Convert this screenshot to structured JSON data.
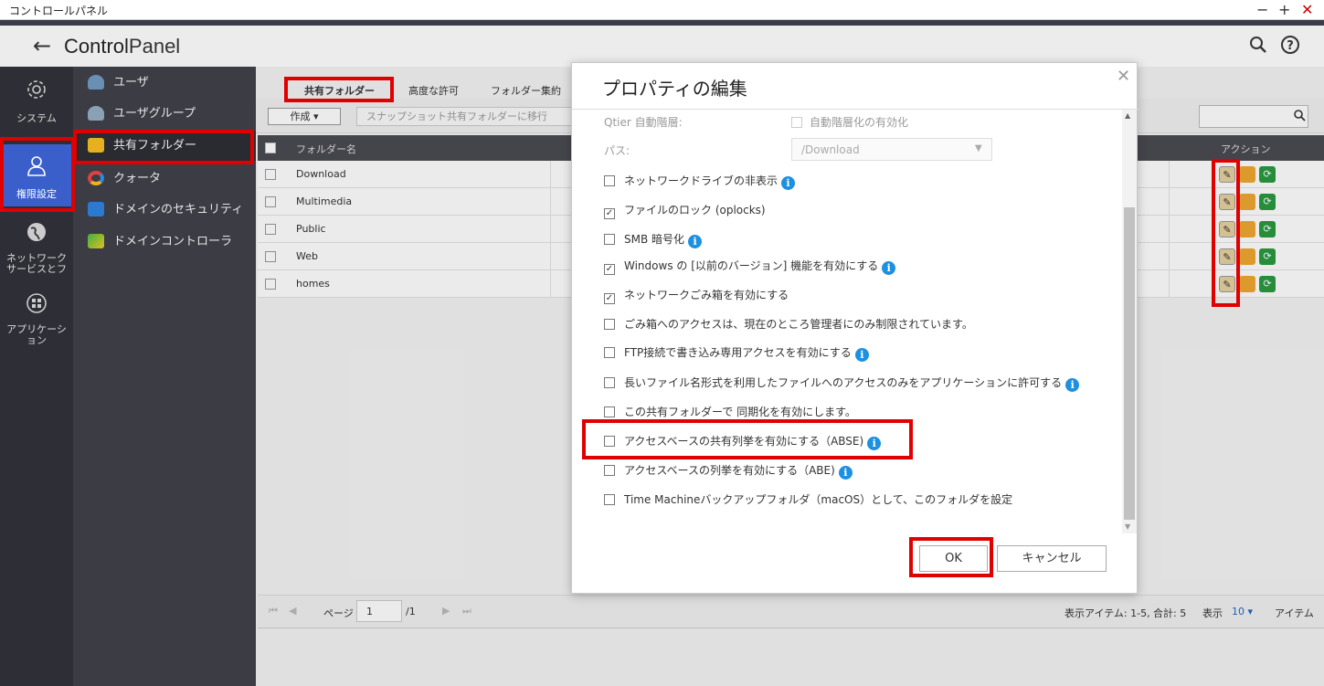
{
  "window": {
    "title": "コントロールパネル",
    "minimize": "−",
    "maximize": "+",
    "close": "✕"
  },
  "header": {
    "brand_bold": "Control",
    "brand_light": "Panel",
    "search_icon": "search-icon",
    "help_icon": "help-icon"
  },
  "leftnav": [
    {
      "label": "システム",
      "icon": "gear-icon"
    },
    {
      "label": "権限設定",
      "icon": "user-icon"
    },
    {
      "label_1": "ネットワーク",
      "label_2": "サービスとフ",
      "icon": "globe-icon"
    },
    {
      "label_1": "アプリケーシ",
      "label_2": "ョン",
      "icon": "apps-icon"
    }
  ],
  "subnav": [
    {
      "label": "ユーザ"
    },
    {
      "label": "ユーザグループ"
    },
    {
      "label": "共有フォルダー"
    },
    {
      "label": "クォータ"
    },
    {
      "label": "ドメインのセキュリティ"
    },
    {
      "label": "ドメインコントローラ"
    }
  ],
  "tabs": [
    {
      "label": "共有フォルダー"
    },
    {
      "label": "高度な許可"
    },
    {
      "label": "フォルダー集約"
    }
  ],
  "toolbar": {
    "create": "作成",
    "snapshot": "スナップショット共有フォルダーに移行"
  },
  "table": {
    "col_name": "フォルダー名",
    "col_action": "アクション",
    "rows": [
      "Download",
      "Multimedia",
      "Public",
      "Web",
      "homes"
    ]
  },
  "pager": {
    "page_label": "ページ",
    "page_value": "1",
    "page_total": "/1",
    "items_info": "表示アイテム: 1-5, 合計: 5",
    "show_label": "表示",
    "show_value": "10",
    "items_label": "アイテム"
  },
  "dialog": {
    "title": "プロパティの編集",
    "qtier_label": "Qtier 自動階層:",
    "qtier_option": "自動階層化の有効化",
    "path_label": "パス:",
    "path_value": "/Download",
    "options": [
      {
        "label": "ネットワークドライブの非表示",
        "checked": false,
        "info": true
      },
      {
        "label": "ファイルのロック (oplocks)",
        "checked": true,
        "info": false
      },
      {
        "label": "SMB 暗号化",
        "checked": false,
        "info": true
      },
      {
        "label": "Windows の [以前のバージョン] 機能を有効にする",
        "checked": true,
        "info": true
      },
      {
        "label": "ネットワークごみ箱を有効にする",
        "checked": true,
        "info": false
      },
      {
        "label": "ごみ箱へのアクセスは、現在のところ管理者にのみ制限されています。",
        "checked": false,
        "info": false
      },
      {
        "label": "FTP接続で書き込み専用アクセスを有効にする",
        "checked": false,
        "info": true
      },
      {
        "label": "長いファイル名形式を利用したファイルへのアクセスのみをアプリケーションに許可する",
        "checked": false,
        "info": true
      },
      {
        "label": "この共有フォルダーで 同期化を有効にします。",
        "checked": false,
        "info": false
      },
      {
        "label": "アクセスベースの共有列挙を有効にする（ABSE)",
        "checked": false,
        "info": true
      },
      {
        "label": "アクセスベースの列挙を有効にする（ABE)",
        "checked": false,
        "info": true
      },
      {
        "label": "Time Machineバックアップフォルダ（macOS）として、このフォルダを設定",
        "checked": false,
        "info": false
      }
    ],
    "ok": "OK",
    "cancel": "キャンセル"
  },
  "colors": {
    "highlight": "#e00000",
    "nav_active": "#3a5fcb",
    "info": "#1e90e0"
  }
}
